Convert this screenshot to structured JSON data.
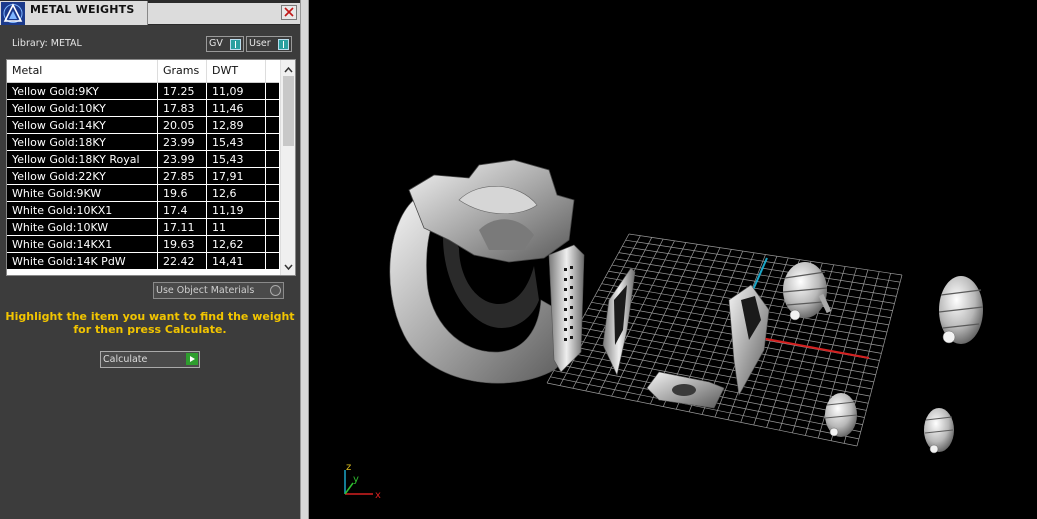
{
  "panel": {
    "title": "METAL WEIGHTS",
    "library_label": "Library: METAL",
    "toggles": {
      "gv": "GV",
      "user": "User"
    },
    "table": {
      "columns": [
        "Metal",
        "Grams",
        "DWT"
      ],
      "rows": [
        [
          "Yellow Gold:9KY",
          "17.25",
          "11,09"
        ],
        [
          "Yellow Gold:10KY",
          "17.83",
          "11,46"
        ],
        [
          "Yellow Gold:14KY",
          "20.05",
          "12,89"
        ],
        [
          "Yellow Gold:18KY",
          "23.99",
          "15,43"
        ],
        [
          "Yellow Gold:18KY Royal",
          "23.99",
          "15,43"
        ],
        [
          "Yellow Gold:22KY",
          "27.85",
          "17,91"
        ],
        [
          "White Gold:9KW",
          "19.6",
          "12,6"
        ],
        [
          "White Gold:10KX1",
          "17.4",
          "11,19"
        ],
        [
          "White Gold:10KW",
          "17.11",
          "11"
        ],
        [
          "White Gold:14KX1",
          "19.63",
          "12,62"
        ],
        [
          "White Gold:14K PdW",
          "22.42",
          "14,41"
        ]
      ]
    },
    "use_object_materials": "Use Object Materials",
    "hint_line1": "Highlight the item you want to find the weight",
    "hint_line2": "for then press Calculate.",
    "calculate_label": "Calculate"
  },
  "viewport": {
    "axis_labels": {
      "z": "z",
      "y": "y",
      "x": "x"
    }
  },
  "colors": {
    "panel_bg": "#3c3c3c",
    "hint": "#f2c500",
    "x_axis": "#d42020",
    "y_axis": "#1aa6c8",
    "grid": "#9a9a9a"
  }
}
